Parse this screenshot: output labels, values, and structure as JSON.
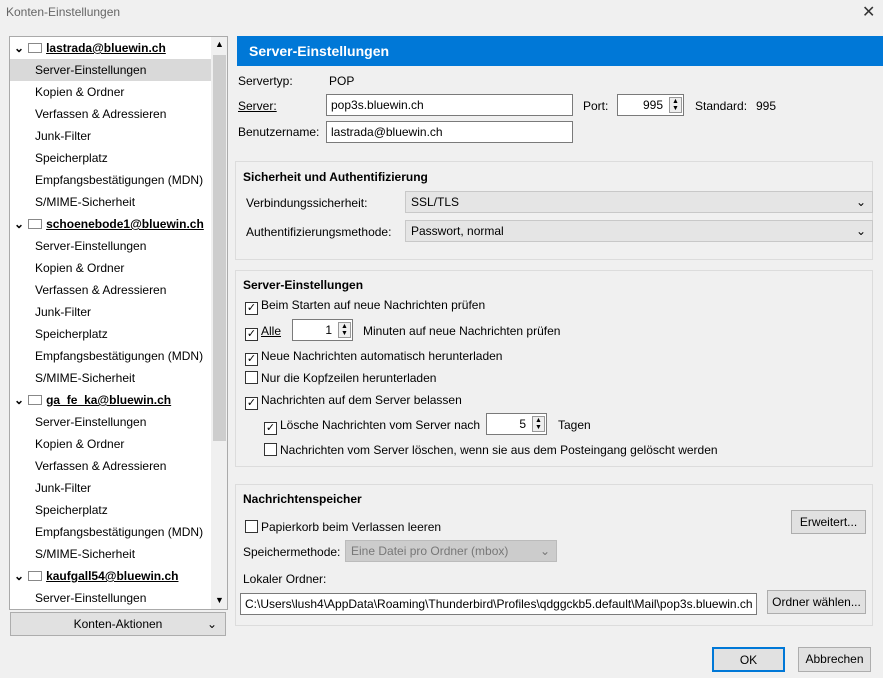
{
  "window": {
    "title": "Konten-Einstellungen",
    "close": "✕"
  },
  "tree": {
    "accounts": [
      {
        "name": "lastrada@bluewin.ch",
        "items": [
          "Server-Einstellungen",
          "Kopien & Ordner",
          "Verfassen & Adressieren",
          "Junk-Filter",
          "Speicherplatz",
          "Empfangsbestätigungen (MDN)",
          "S/MIME-Sicherheit"
        ]
      },
      {
        "name": "schoenebode1@bluewin.ch",
        "items": [
          "Server-Einstellungen",
          "Kopien & Ordner",
          "Verfassen & Adressieren",
          "Junk-Filter",
          "Speicherplatz",
          "Empfangsbestätigungen (MDN)",
          "S/MIME-Sicherheit"
        ]
      },
      {
        "name": "ga_fe_ka@bluewin.ch",
        "items": [
          "Server-Einstellungen",
          "Kopien & Ordner",
          "Verfassen & Adressieren",
          "Junk-Filter",
          "Speicherplatz",
          "Empfangsbestätigungen (MDN)",
          "S/MIME-Sicherheit"
        ]
      },
      {
        "name": "kaufgall54@bluewin.ch",
        "items": [
          "Server-Einstellungen"
        ]
      }
    ],
    "actions": "Konten-Aktionen"
  },
  "main": {
    "header": "Server-Einstellungen",
    "servertype_label": "Servertyp:",
    "servertype": "POP",
    "server_label": "Server:",
    "server": "pop3s.bluewin.ch",
    "port_label": "Port:",
    "port": "995",
    "standard_label": "Standard:",
    "standard": "995",
    "user_label": "Benutzername:",
    "user": "lastrada@bluewin.ch",
    "security": {
      "title": "Sicherheit und Authentifizierung",
      "conn_label": "Verbindungssicherheit:",
      "conn": "SSL/TLS",
      "auth_label": "Authentifizierungsmethode:",
      "auth": "Passwort, normal"
    },
    "settings": {
      "title": "Server-Einstellungen",
      "check_start": "Beim Starten auf neue Nachrichten prüfen",
      "every": "Alle",
      "minutes": "1",
      "minutes_label": "Minuten auf neue Nachrichten prüfen",
      "auto_download": "Neue Nachrichten automatisch herunterladen",
      "headers_only": "Nur die Kopfzeilen herunterladen",
      "leave": "Nachrichten auf dem Server belassen",
      "delete_after": "Lösche Nachrichten vom Server nach",
      "days": "5",
      "days_label": "Tagen",
      "delete_inbox": "Nachrichten vom Server löschen, wenn sie aus dem Posteingang gelöscht werden"
    },
    "storage": {
      "title": "Nachrichtenspeicher",
      "empty_trash": "Papierkorb beim Verlassen leeren",
      "advanced": "Erweitert...",
      "method_label": "Speichermethode:",
      "method": "Eine Datei pro Ordner (mbox)",
      "folder_label": "Lokaler Ordner:",
      "folder": "C:\\Users\\lush4\\AppData\\Roaming\\Thunderbird\\Profiles\\qdggckb5.default\\Mail\\pop3s.bluewin.ch",
      "choose": "Ordner wählen..."
    }
  },
  "footer": {
    "ok": "OK",
    "cancel": "Abbrechen"
  }
}
